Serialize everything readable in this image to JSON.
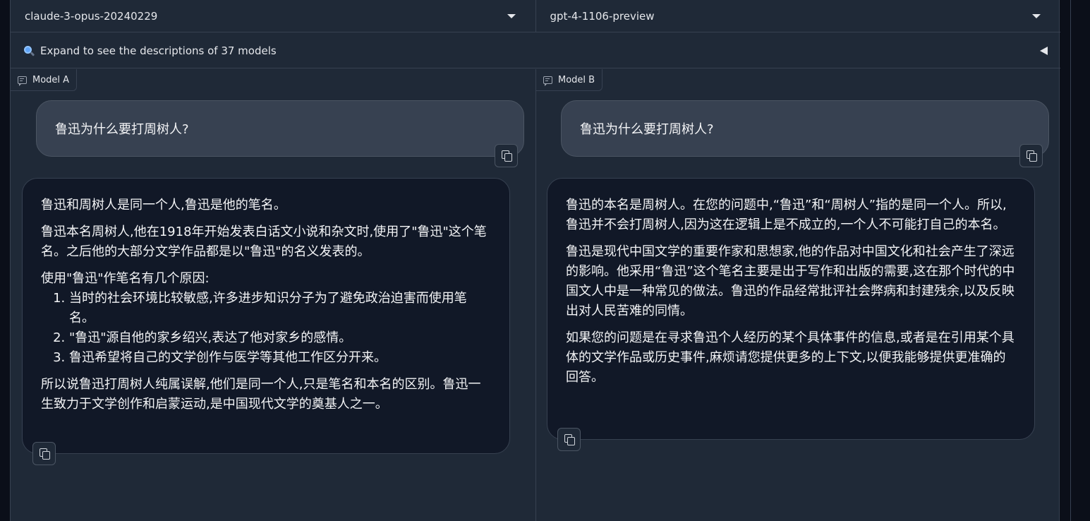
{
  "model_selectors": {
    "model_a": "claude-3-opus-20240229",
    "model_b": "gpt-4-1106-preview"
  },
  "accordion": {
    "label": "Expand to see the descriptions of 37 models"
  },
  "panel_a": {
    "label": "Model A",
    "user_message": "鲁迅为什么要打周树人?",
    "reply": {
      "p1": "鲁迅和周树人是同一个人,鲁迅是他的笔名。",
      "p2": "鲁迅本名周树人,他在1918年开始发表白话文小说和杂文时,使用了\"鲁迅\"这个笔名。之后他的大部分文学作品都是以\"鲁迅\"的名义发表的。",
      "p3": "使用\"鲁迅\"作笔名有几个原因:",
      "list": [
        "当时的社会环境比较敏感,许多进步知识分子为了避免政治迫害而使用笔名。",
        "\"鲁迅\"源自他的家乡绍兴,表达了他对家乡的感情。",
        "鲁迅希望将自己的文学创作与医学等其他工作区分开来。"
      ],
      "p4": "所以说鲁迅打周树人纯属误解,他们是同一个人,只是笔名和本名的区别。鲁迅一生致力于文学创作和启蒙运动,是中国现代文学的奠基人之一。"
    }
  },
  "panel_b": {
    "label": "Model B",
    "user_message": "鲁迅为什么要打周树人?",
    "reply": {
      "p1": "鲁迅的本名是周树人。在您的问题中,“鲁迅”和“周树人”指的是同一个人。所以,鲁迅并不会打周树人,因为这在逻辑上是不成立的,一个人不可能打自己的本名。",
      "p2": "鲁迅是现代中国文学的重要作家和思想家,他的作品对中国文化和社会产生了深远的影响。他采用“鲁迅”这个笔名主要是出于写作和出版的需要,这在那个时代的中国文人中是一种常见的做法。鲁迅的作品经常批评社会弊病和封建残余,以及反映出对人民苦难的同情。",
      "p3": "如果您的问题是在寻求鲁迅个人经历的某个具体事件的信息,或者是在引用某个具体的文学作品或历史事件,麻烦请您提供更多的上下文,以便我能够提供更准确的回答。"
    }
  },
  "icons": {
    "accordion": "magnifier-icon",
    "collapse": "triangle-left-icon",
    "label": "chat-bubble-icon",
    "copy": "copy-icon"
  }
}
